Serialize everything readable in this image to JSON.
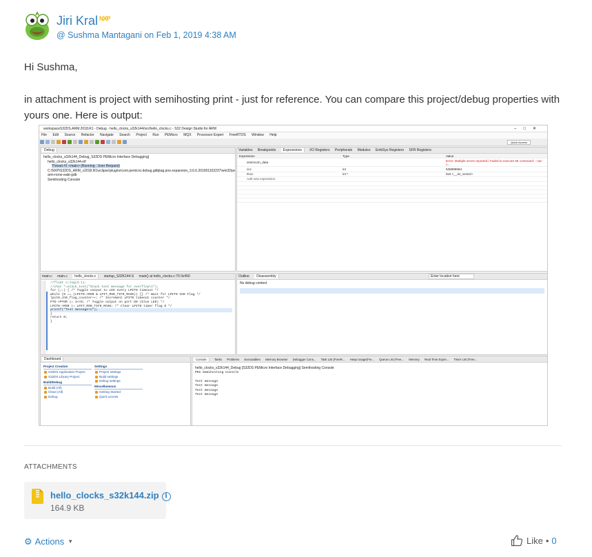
{
  "post": {
    "author": "Jiri Kral",
    "author_badge": "NXP",
    "reply_to": "@ Sushma Mantagani",
    "date_prefix": "on",
    "date": "Feb 1, 2019 4:38 AM",
    "greeting": "Hi Sushma,",
    "body": "in attachment is project with semihosting print - just for reference. You can compare this project/debug properties with yours one. Here is output:"
  },
  "screenshot": {
    "window_title": "workspaceS32DS.ARM.2018.R1 - Debug - hello_clocks_s32k144/src/hello_clocks.c - S32 Design Studio for ARM",
    "menu": [
      "File",
      "Edit",
      "Source",
      "Refactor",
      "Navigate",
      "Search",
      "Project",
      "Run",
      "PEMicro",
      "MQX",
      "Processor Expert",
      "FreeRTOS",
      "Window",
      "Help"
    ],
    "quick_access": "Quick Access",
    "debug_tab": "Debug",
    "debug_tree": [
      "hello_clocks_s32k144_Debug_S32DS PEMicro Interface Debugging]",
      "hello_clocks_s32k144.elf",
      "Thread #1 <main> (Running : User Request)",
      "C:\\NXP\\S32DS_ARM_v2018.R1\\eclipse\\plugins\\com.pemicro.debug.gdbjtag.pne.expansion_3.6.6.201901102237\\win32\\pegdbser",
      "arm-none-eabi-gdb",
      "Semihosting Console"
    ],
    "view_tabs": [
      "Variables",
      "Breakpoints",
      "Expressions",
      "I/O Registers",
      "Peripherals",
      "Modules",
      "EmbSys Registers",
      "SFR Registers"
    ],
    "expr_headers": [
      "Expression",
      "Type",
      "Value"
    ],
    "expr_rows": [
      {
        "expr": "xsemcom_data",
        "type": "",
        "value": "Error: Multiple errors reported.\\ Failed to execute MI command: --var-c..."
      },
      {
        "expr": "ccc",
        "type": "int",
        "value": "536899584"
      },
      {
        "expr": "#ccc",
        "type": "int *",
        "value": "0x0 <__isr_vector>"
      },
      {
        "expr": "Add new expression",
        "type": "",
        "value": ""
      }
    ],
    "editor_tabs": [
      "main.c",
      "main.c",
      "hello_clocks.c",
      "startup_S32K144.S",
      "main() at hello_clocks.c:70 0x450"
    ],
    "code_lines": [
      "//float c=log(3.1);",
      "",
      "//char *=stack_test(\"Stack test message for overflow\\n\");",
      "",
      "",
      "for (;;) {                    /* Toggle output to LED every LPIT0 timeout */",
      "  while (0 == (LPIT0->MSR & LPIT_MSR_TIF0_MASK)) {} /* Wait for LPIT0 CH0 Flag */",
      "  lpit0_ch0_flag_counter++;        /* Increment LPIT0 timeout counter */",
      "  PTD->PTOR |= 1<<0;             /* Toggle output on port D0 (blue LED) */",
      "  LPIT0->MSR |= LPIT_MSR_TIF0_MASK; /* Clear LPIT0 timer flag 0 */",
      "  printf(\"Test message\\n\");",
      "}",
      "",
      "  return 0;",
      "}"
    ],
    "dis_tabs": [
      "Outline",
      "Disassembly"
    ],
    "location_placeholder": "Enter location here",
    "no_debug_context": "No debug context",
    "dashboard_tab": "Dashboard",
    "dash_sections": {
      "project_creation": "Project Creation",
      "project_links": [
        "S32DS Application Project",
        "S32DS Library Project"
      ],
      "build_debug": "Build/Debug",
      "build_links": [
        "Build  (All)",
        "Clean  (All)",
        "Debug"
      ],
      "settings": "Settings",
      "settings_links": [
        "Project settings",
        "Build settings",
        "Debug settings"
      ],
      "misc": "Miscellaneous",
      "misc_links": [
        "Getting Started",
        "Quick access"
      ]
    },
    "console_tabs": [
      "Console",
      "Tasks",
      "Problems",
      "Executables",
      "Memory Browser",
      "Debugger Cons...",
      "Task List (FreeR...",
      "Heap Usage(Fre...",
      "Queue List (Free...",
      "Memory",
      "Real Time Expre...",
      "Timer List (Free..."
    ],
    "console_title": "hello_clocks_s32k144_Debug [S32DS PEMicro Interface Debugging] Semihosting Console",
    "console_lines": [
      "PEG Semihosting Console",
      "",
      "Test message",
      "Test message",
      "Test message",
      "Test message"
    ]
  },
  "attachments": {
    "heading": "ATTACHMENTS",
    "file_name": "hello_clocks_s32k144.zip",
    "file_size": "164.9 KB",
    "icon": "zip-file-icon"
  },
  "footer": {
    "actions_label": "Actions",
    "like_label": "Like",
    "like_count": "0"
  },
  "colors": {
    "link": "#2f7fbf",
    "text": "#333333",
    "zip": "#f3c315"
  }
}
